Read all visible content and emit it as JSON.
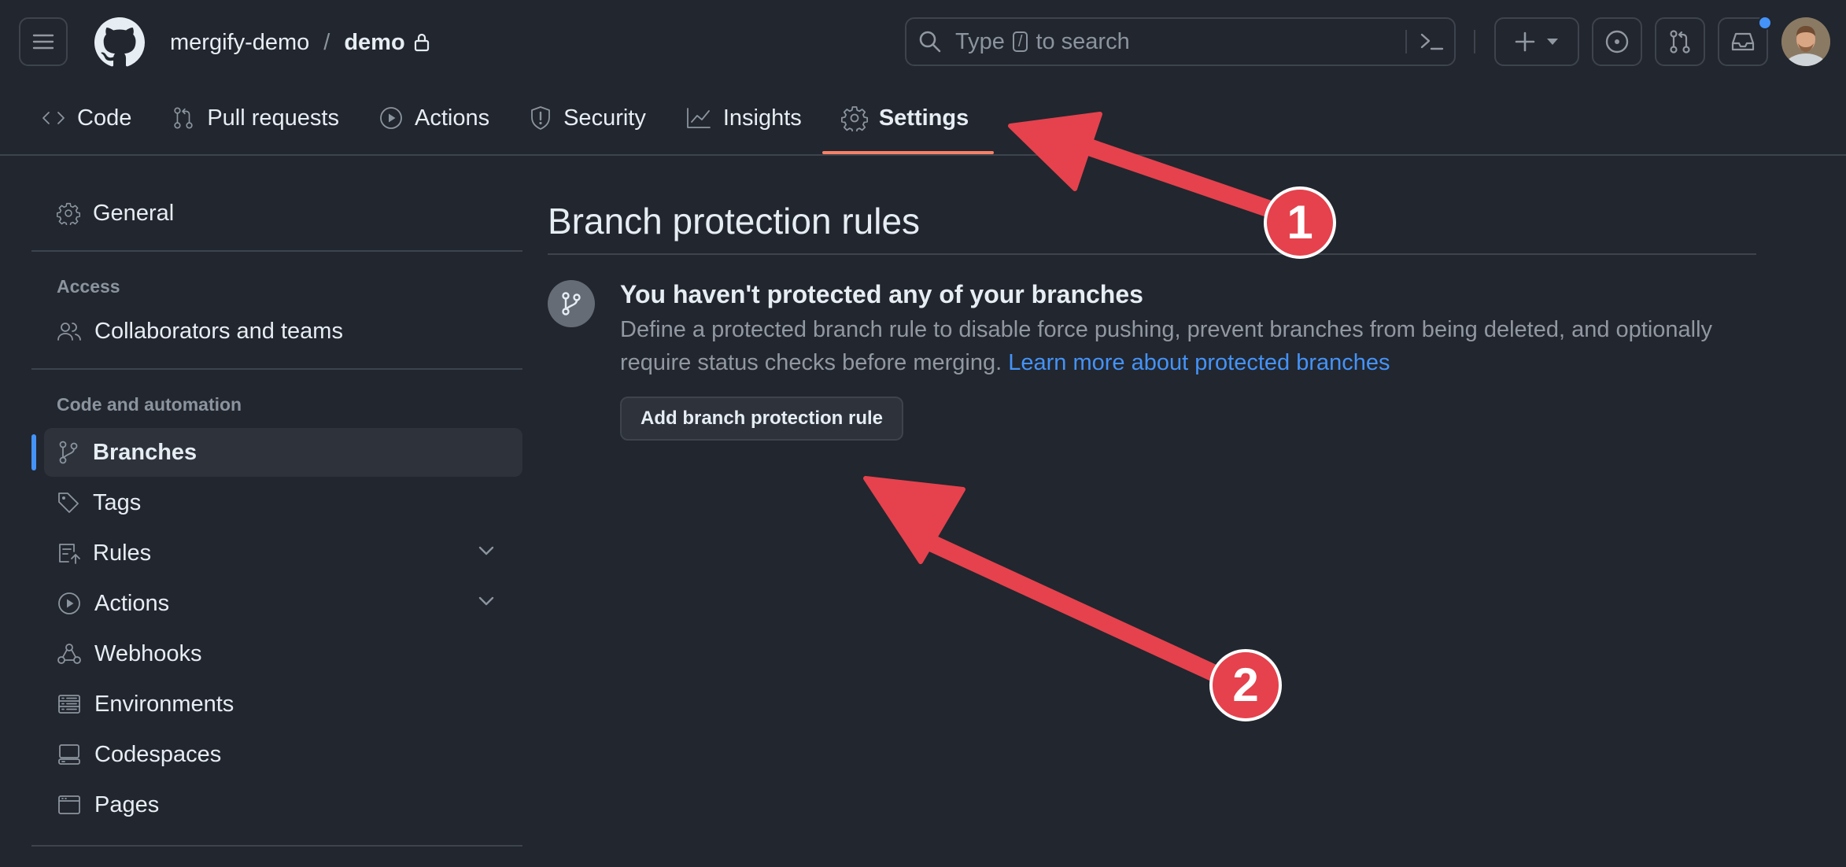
{
  "header": {
    "owner": "mergify-demo",
    "separator": "/",
    "repo": "demo",
    "search_placeholder_before": "Type",
    "search_key": "/",
    "search_placeholder_after": "to search"
  },
  "tabs": [
    {
      "label": "Code",
      "icon": "code-icon"
    },
    {
      "label": "Pull requests",
      "icon": "pull-request-icon"
    },
    {
      "label": "Actions",
      "icon": "play-icon"
    },
    {
      "label": "Security",
      "icon": "shield-icon"
    },
    {
      "label": "Insights",
      "icon": "graph-icon"
    },
    {
      "label": "Settings",
      "icon": "gear-icon",
      "active": true
    }
  ],
  "sidebar": {
    "general": "General",
    "access_heading": "Access",
    "collaborators": "Collaborators and teams",
    "code_heading": "Code and automation",
    "items": [
      {
        "label": "Branches",
        "icon": "branch-icon"
      },
      {
        "label": "Tags",
        "icon": "tag-icon"
      },
      {
        "label": "Rules",
        "icon": "rules-icon"
      },
      {
        "label": "Actions",
        "icon": "play-icon"
      },
      {
        "label": "Webhooks",
        "icon": "webhook-icon"
      },
      {
        "label": "Environments",
        "icon": "server-icon"
      },
      {
        "label": "Codespaces",
        "icon": "codespaces-icon"
      },
      {
        "label": "Pages",
        "icon": "browser-icon"
      }
    ]
  },
  "main": {
    "title": "Branch protection rules",
    "blank_title": "You haven't protected any of your branches",
    "blank_desc": "Define a protected branch rule to disable force pushing, prevent branches from being deleted, and optionally require status checks before merging.",
    "learn_more": "Learn more about protected branches",
    "add_button": "Add branch protection rule"
  },
  "annotations": {
    "marker1": "1",
    "marker2": "2",
    "color": "#e5424d"
  },
  "colors": {
    "background": "#22262e",
    "accent": "#4493f8",
    "tab_underline": "#f78166"
  }
}
